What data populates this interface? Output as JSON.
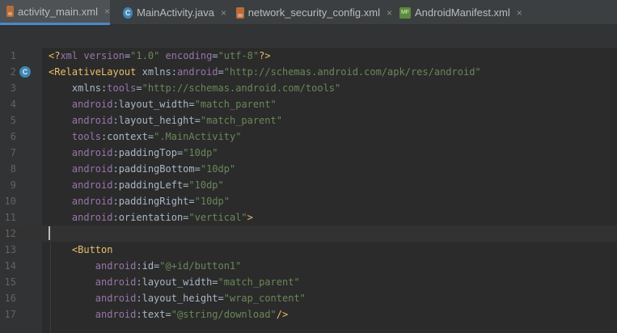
{
  "tabs": [
    {
      "label": "activity_main.xml",
      "icon": "xml-file-icon",
      "active": true
    },
    {
      "label": "MainActivity.java",
      "icon": "java-class-icon",
      "active": false
    },
    {
      "label": "network_security_config.xml",
      "icon": "xml-file-icon",
      "active": false
    },
    {
      "label": "AndroidManifest.xml",
      "icon": "manifest-file-icon",
      "active": false
    }
  ],
  "close_glyph": "×",
  "gutter": {
    "class_marker_letter": "C",
    "class_marker_line": "2",
    "current_line": "12"
  },
  "lines": [
    {
      "num": "1",
      "tokens": [
        {
          "t": "tag",
          "v": "<?"
        },
        {
          "t": "ns",
          "v": "xml "
        },
        {
          "t": "ns",
          "v": "version"
        },
        {
          "t": "txt",
          "v": "="
        },
        {
          "t": "str",
          "v": "\"1.0\" "
        },
        {
          "t": "ns",
          "v": "encoding"
        },
        {
          "t": "txt",
          "v": "="
        },
        {
          "t": "str",
          "v": "\"utf-8\""
        },
        {
          "t": "tag",
          "v": "?>"
        }
      ]
    },
    {
      "num": "2",
      "tokens": [
        {
          "t": "tag",
          "v": "<RelativeLayout "
        },
        {
          "t": "txt",
          "v": "xmlns:"
        },
        {
          "t": "ns",
          "v": "android"
        },
        {
          "t": "txt",
          "v": "="
        },
        {
          "t": "str",
          "v": "\"http://schemas.android.com/apk/res/android\""
        }
      ]
    },
    {
      "num": "3",
      "tokens": [
        {
          "t": "txt",
          "v": "    xmlns:"
        },
        {
          "t": "ns",
          "v": "tools"
        },
        {
          "t": "txt",
          "v": "="
        },
        {
          "t": "str",
          "v": "\"http://schemas.android.com/tools\""
        }
      ]
    },
    {
      "num": "4",
      "tokens": [
        {
          "t": "ns",
          "v": "    android"
        },
        {
          "t": "txt",
          "v": ":layout_width="
        },
        {
          "t": "str",
          "v": "\"match_parent\""
        }
      ]
    },
    {
      "num": "5",
      "tokens": [
        {
          "t": "ns",
          "v": "    android"
        },
        {
          "t": "txt",
          "v": ":layout_height="
        },
        {
          "t": "str",
          "v": "\"match_parent\""
        }
      ]
    },
    {
      "num": "6",
      "tokens": [
        {
          "t": "ns",
          "v": "    tools"
        },
        {
          "t": "txt",
          "v": ":context="
        },
        {
          "t": "str",
          "v": "\".MainActivity\""
        }
      ]
    },
    {
      "num": "7",
      "tokens": [
        {
          "t": "ns",
          "v": "    android"
        },
        {
          "t": "txt",
          "v": ":paddingTop="
        },
        {
          "t": "str",
          "v": "\"10dp\""
        }
      ]
    },
    {
      "num": "8",
      "tokens": [
        {
          "t": "ns",
          "v": "    android"
        },
        {
          "t": "txt",
          "v": ":paddingBottom="
        },
        {
          "t": "str",
          "v": "\"10dp\""
        }
      ]
    },
    {
      "num": "9",
      "tokens": [
        {
          "t": "ns",
          "v": "    android"
        },
        {
          "t": "txt",
          "v": ":paddingLeft="
        },
        {
          "t": "str",
          "v": "\"10dp\""
        }
      ]
    },
    {
      "num": "10",
      "tokens": [
        {
          "t": "ns",
          "v": "    android"
        },
        {
          "t": "txt",
          "v": ":paddingRight="
        },
        {
          "t": "str",
          "v": "\"10dp\""
        }
      ]
    },
    {
      "num": "11",
      "tokens": [
        {
          "t": "ns",
          "v": "    android"
        },
        {
          "t": "txt",
          "v": ":orientation="
        },
        {
          "t": "str",
          "v": "\"vertical\""
        },
        {
          "t": "tag",
          "v": ">"
        }
      ]
    },
    {
      "num": "12",
      "tokens": []
    },
    {
      "num": "13",
      "tokens": [
        {
          "t": "tag",
          "v": "    <Button"
        }
      ]
    },
    {
      "num": "14",
      "tokens": [
        {
          "t": "ns",
          "v": "        android"
        },
        {
          "t": "txt",
          "v": ":id="
        },
        {
          "t": "str",
          "v": "\"@+id/button1\""
        }
      ]
    },
    {
      "num": "15",
      "tokens": [
        {
          "t": "ns",
          "v": "        android"
        },
        {
          "t": "txt",
          "v": ":layout_width="
        },
        {
          "t": "str",
          "v": "\"match_parent\""
        }
      ]
    },
    {
      "num": "16",
      "tokens": [
        {
          "t": "ns",
          "v": "        android"
        },
        {
          "t": "txt",
          "v": ":layout_height="
        },
        {
          "t": "str",
          "v": "\"wrap_content\""
        }
      ]
    },
    {
      "num": "17",
      "tokens": [
        {
          "t": "ns",
          "v": "        android"
        },
        {
          "t": "txt",
          "v": ":text="
        },
        {
          "t": "str",
          "v": "\"@string/download\""
        },
        {
          "t": "tag",
          "v": "/>"
        }
      ]
    }
  ],
  "colors": {
    "bg": "#2b2b2b",
    "tag": "#e8bf6a",
    "attr_ns": "#9876aa",
    "string": "#6a8759",
    "text": "#a9b7c6",
    "accent": "#4a88c7"
  }
}
